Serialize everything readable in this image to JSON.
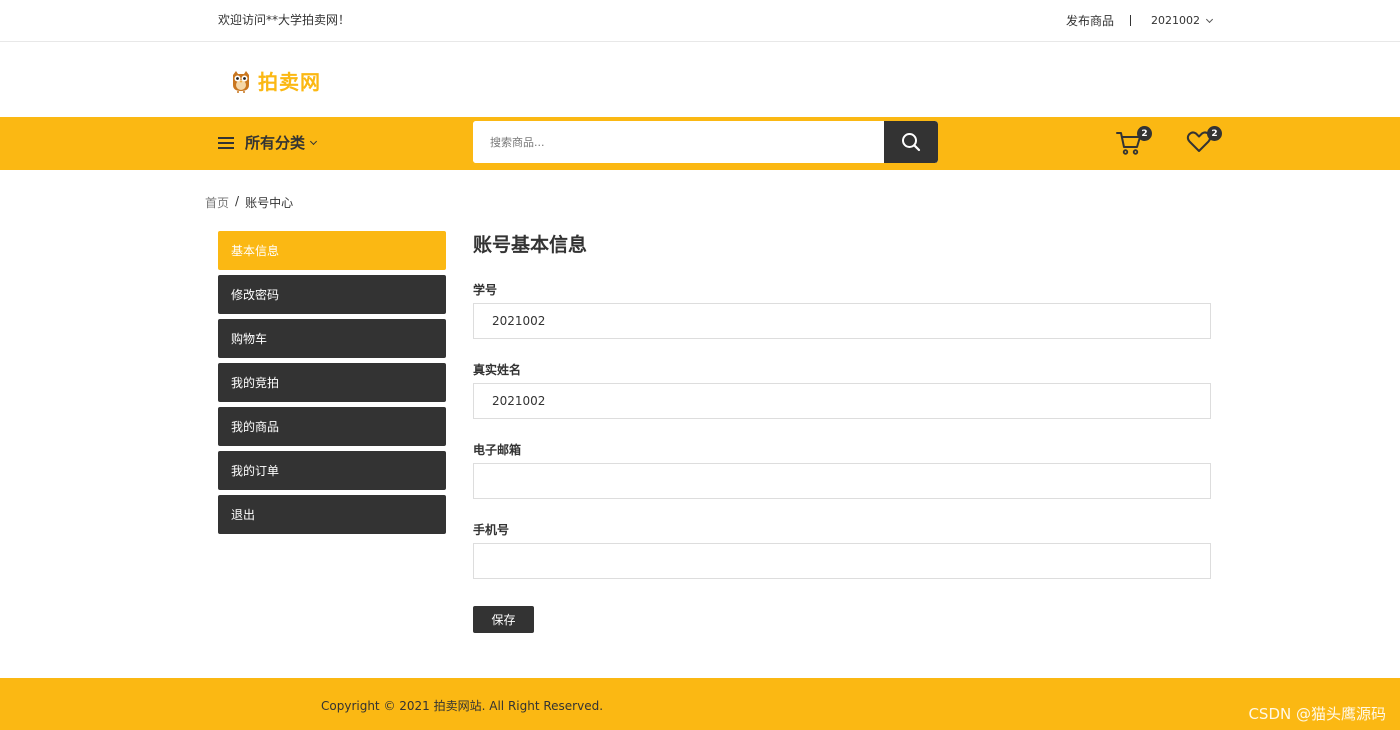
{
  "topbar": {
    "welcome": "欢迎访问**大学拍卖网！",
    "publish": "发布商品",
    "user": "2021002"
  },
  "logo": {
    "text": "拍卖网",
    "icon": "owl-logo-icon"
  },
  "nav": {
    "categories": "所有分类",
    "search_placeholder": "搜索商品...",
    "cart_count": "2",
    "wishlist_count": "2"
  },
  "breadcrumb": {
    "home": "首页",
    "separator": "/",
    "current": "账号中心"
  },
  "sidebar": {
    "items": [
      {
        "label": "基本信息",
        "active": true
      },
      {
        "label": "修改密码",
        "active": false
      },
      {
        "label": "购物车",
        "active": false
      },
      {
        "label": "我的竞拍",
        "active": false
      },
      {
        "label": "我的商品",
        "active": false
      },
      {
        "label": "我的订单",
        "active": false
      },
      {
        "label": "退出",
        "active": false
      }
    ]
  },
  "form": {
    "title": "账号基本信息",
    "fields": [
      {
        "label": "学号",
        "value": "2021002"
      },
      {
        "label": "真实姓名",
        "value": "2021002"
      },
      {
        "label": "电子邮箱",
        "value": ""
      },
      {
        "label": "手机号",
        "value": ""
      }
    ],
    "save": "保存"
  },
  "footer": {
    "copyright": "Copyright © 2021 拍卖网站. All Right Reserved.",
    "watermark": "CSDN @猫头鹰源码"
  },
  "colors": {
    "accent": "#fbb813",
    "dark": "#333333"
  }
}
